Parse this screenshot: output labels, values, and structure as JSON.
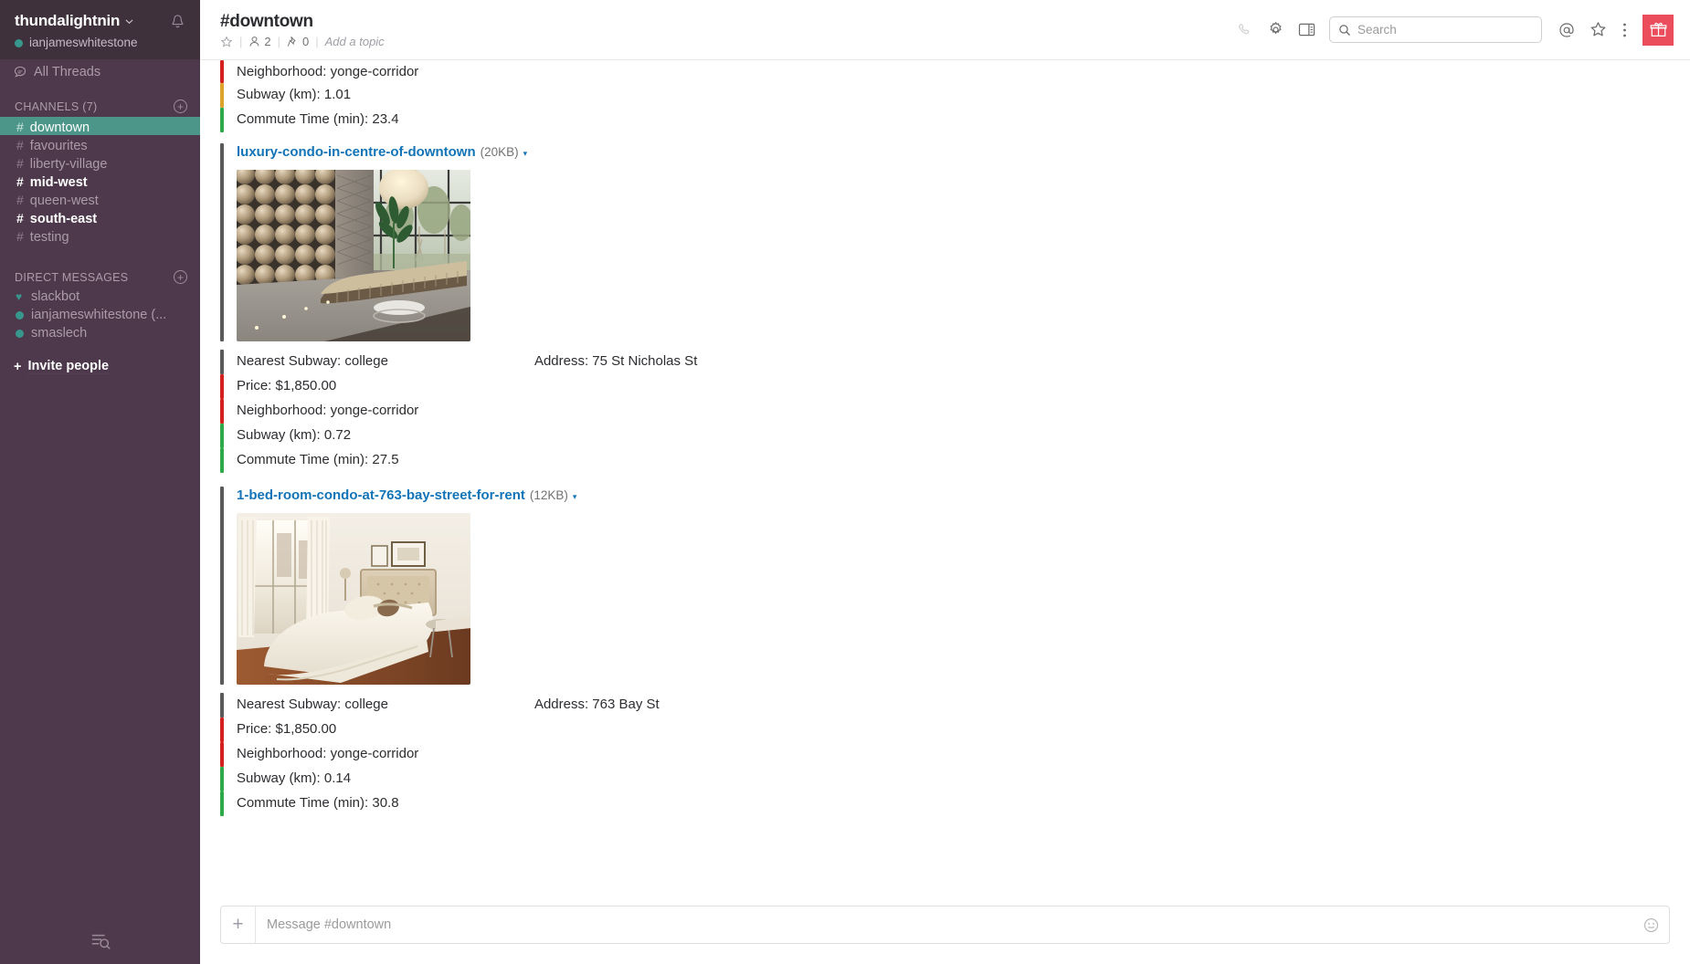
{
  "sidebar": {
    "team_name": "thundalightnin",
    "team_caret": "⌄",
    "user_name": "ianjameswhitestone",
    "bell_icon": "bell-icon",
    "all_threads": "All Threads",
    "channels_section": {
      "title": "CHANNELS",
      "count": "(7)"
    },
    "channels": [
      {
        "name": "downtown",
        "state": "active"
      },
      {
        "name": "favourites",
        "state": "normal"
      },
      {
        "name": "liberty-village",
        "state": "normal"
      },
      {
        "name": "mid-west",
        "state": "unread"
      },
      {
        "name": "queen-west",
        "state": "normal"
      },
      {
        "name": "south-east",
        "state": "unread"
      },
      {
        "name": "testing",
        "state": "normal"
      }
    ],
    "dm_section": {
      "title": "DIRECT MESSAGES"
    },
    "dms": [
      {
        "name": "slackbot",
        "marker": "heart"
      },
      {
        "name": "ianjameswhitestone (...",
        "marker": "dot"
      },
      {
        "name": "smaslech",
        "marker": "dot"
      }
    ],
    "invite": {
      "plus": "+",
      "label": "Invite people"
    },
    "bottom_icon": "channel-browser-icon"
  },
  "header": {
    "title": "#downtown",
    "star_icon": "star-outline-icon",
    "members_icon": "person-icon",
    "members_count": "2",
    "pins_icon": "pin-icon",
    "pins_count": "0",
    "topic_placeholder": "Add a topic",
    "separator": "|",
    "icons": {
      "call": "phone-icon",
      "settings": "gear-icon",
      "panel": "sidebar-toggle-icon",
      "mentions": "at-icon",
      "stars": "star-outline-icon",
      "more": "kebab-menu-icon",
      "gift": "gift-icon"
    },
    "search": {
      "icon": "search-icon",
      "placeholder": "Search"
    }
  },
  "messages": {
    "partial_top": {
      "fields": [
        {
          "label": "Neighborhood: yonge-corridor",
          "color": "#d42020"
        },
        {
          "label": "Subway (km): 1.01",
          "color": "#dda32b"
        },
        {
          "label": "Commute Time (min): 23.4",
          "color": "#2eaa4a"
        }
      ]
    },
    "attachments": [
      {
        "file_name": "luxury-condo-in-centre-of-downtown",
        "file_size": "(20KB)",
        "caret": "▾",
        "bar_color": "#5a5a5a",
        "image_alt": "condo-lobby-photo",
        "primary_left": "Nearest Subway: college",
        "primary_right": "Address: 75 St Nicholas St",
        "fields": [
          {
            "label": "Price: $1,850.00",
            "color": "#d42020"
          },
          {
            "label": "Neighborhood: yonge-corridor",
            "color": "#d42020"
          },
          {
            "label": "Subway (km): 0.72",
            "color": "#2eaa4a"
          },
          {
            "label": "Commute Time (min): 27.5",
            "color": "#2eaa4a"
          }
        ]
      },
      {
        "file_name": "1-bed-room-condo-at-763-bay-street-for-rent",
        "file_size": "(12KB)",
        "caret": "▾",
        "bar_color": "#5a5a5a",
        "image_alt": "bedroom-photo",
        "primary_left": "Nearest Subway: college",
        "primary_right": "Address: 763 Bay St",
        "fields": [
          {
            "label": "Price: $1,850.00",
            "color": "#d42020"
          },
          {
            "label": "Neighborhood: yonge-corridor",
            "color": "#d42020"
          },
          {
            "label": "Subway (km): 0.14",
            "color": "#2eaa4a"
          },
          {
            "label": "Commute Time (min): 30.8",
            "color": "#2eaa4a"
          }
        ]
      }
    ]
  },
  "composer": {
    "plus": "+",
    "placeholder": "Message #downtown",
    "emoji_icon": "emoji-icon"
  },
  "colors": {
    "sidebar_bg": "#4d394b",
    "sidebar_header_bg": "#3e313c",
    "active_channel": "#4c9689",
    "link_blue": "#1274b7",
    "gift_red": "#eb4d5c",
    "presence_green": "#38978d"
  }
}
